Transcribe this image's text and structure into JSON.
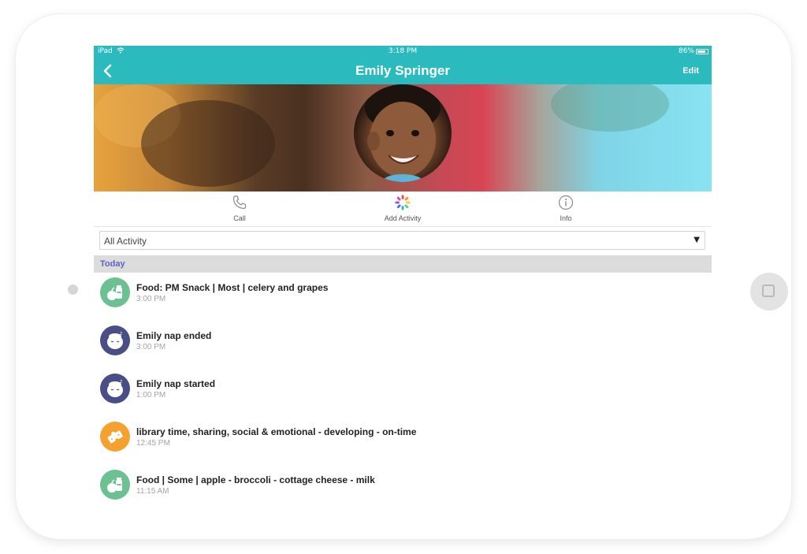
{
  "status_bar": {
    "device": "iPad",
    "time": "3:18 PM",
    "battery": "86%",
    "battery_level": 0.86
  },
  "nav": {
    "title": "Emily Springer",
    "edit_label": "Edit"
  },
  "actions": [
    {
      "label": "Call",
      "icon": "phone-icon"
    },
    {
      "label": "Add Activity",
      "icon": "activity-burst-icon"
    },
    {
      "label": "Info",
      "icon": "info-icon"
    }
  ],
  "filter": {
    "selected": "All Activity"
  },
  "section": {
    "label": "Today"
  },
  "activities": [
    {
      "title": "Food: PM Snack | Most | celery and grapes",
      "time": "3:00 PM",
      "icon": "food-icon",
      "color": "#6cc193"
    },
    {
      "title": "Emily nap ended",
      "time": "3:00 PM",
      "icon": "nap-icon",
      "color": "#494f86"
    },
    {
      "title": "Emily nap started",
      "time": "1:00 PM",
      "icon": "nap-icon",
      "color": "#494f86"
    },
    {
      "title": "library time, sharing, social & emotional - developing - on-time",
      "time": "12:45 PM",
      "icon": "puzzle-icon",
      "color": "#f4a22f"
    },
    {
      "title": "Food | Some | apple - broccoli - cottage cheese - milk",
      "time": "11:15 AM",
      "icon": "food-icon",
      "color": "#6cc193"
    }
  ],
  "colors": {
    "accent": "#2bbabd",
    "section_text": "#5b62c9"
  }
}
